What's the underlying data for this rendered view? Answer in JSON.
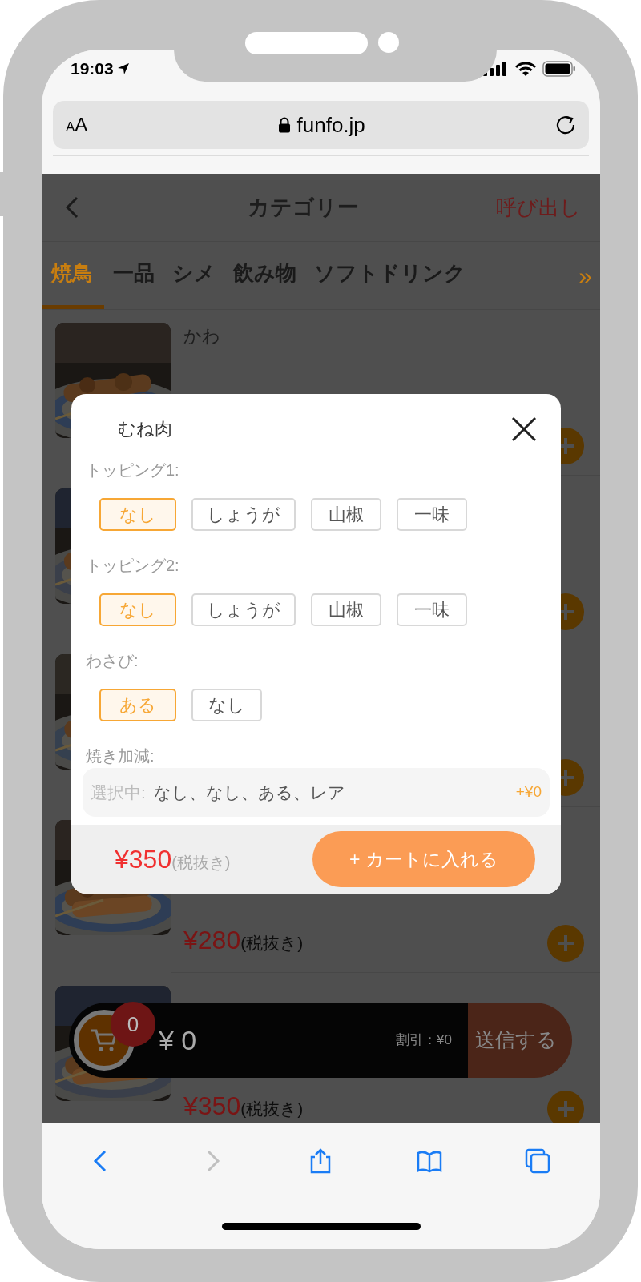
{
  "status_bar": {
    "time": "19:03"
  },
  "browser": {
    "text_size_button": "AA",
    "url": "funfo.jp"
  },
  "header": {
    "title": "カテゴリー",
    "call_button": "呼び出し"
  },
  "category_tabs": [
    {
      "label": "焼鳥",
      "selected": true
    },
    {
      "label": "一品",
      "selected": false
    },
    {
      "label": "シメ",
      "selected": false
    },
    {
      "label": "飲み物",
      "selected": false
    },
    {
      "label": "ソフトドリンク",
      "selected": false
    }
  ],
  "more_tabs": "»",
  "menu_items": [
    {
      "kind": "dish",
      "name": "かわ"
    },
    {
      "kind": "dish"
    },
    {
      "kind": "dish"
    },
    {
      "kind": "dish",
      "price": "¥280",
      "tax_note": "(税抜き)"
    },
    {
      "kind": "dish",
      "price": "¥350",
      "tax_note": "(税抜き)"
    }
  ],
  "modal": {
    "title": "むね肉",
    "option_groups": [
      {
        "label": "トッピング1:",
        "options": [
          {
            "label": "なし",
            "selected": true
          },
          {
            "label": "しょうが",
            "selected": false
          },
          {
            "label": "山椒",
            "selected": false
          },
          {
            "label": "一味",
            "selected": false
          }
        ]
      },
      {
        "label": "トッピング2:",
        "options": [
          {
            "label": "なし",
            "selected": true
          },
          {
            "label": "しょうが",
            "selected": false
          },
          {
            "label": "山椒",
            "selected": false
          },
          {
            "label": "一味",
            "selected": false
          }
        ]
      },
      {
        "label": "わさび:",
        "options": [
          {
            "label": "ある",
            "selected": true
          },
          {
            "label": "なし",
            "selected": false
          }
        ]
      },
      {
        "label": "焼き加減:"
      }
    ],
    "summary_label": "選択中:",
    "summary": "なし、なし、ある、レア",
    "extra_price": "+¥0",
    "price": "¥350",
    "tax_note": "(税抜き)",
    "add_button": "+ カートに入れる"
  },
  "cart_bar": {
    "count": "0",
    "total": "¥ 0",
    "discount": "割引：¥0",
    "send_button": "送信する"
  },
  "toolbar": [
    {
      "kind": "back",
      "disabled": false
    },
    {
      "kind": "forward",
      "disabled": true
    },
    {
      "kind": "share",
      "disabled": false
    },
    {
      "kind": "bookmarks",
      "disabled": false
    },
    {
      "kind": "tabs",
      "disabled": false
    }
  ]
}
